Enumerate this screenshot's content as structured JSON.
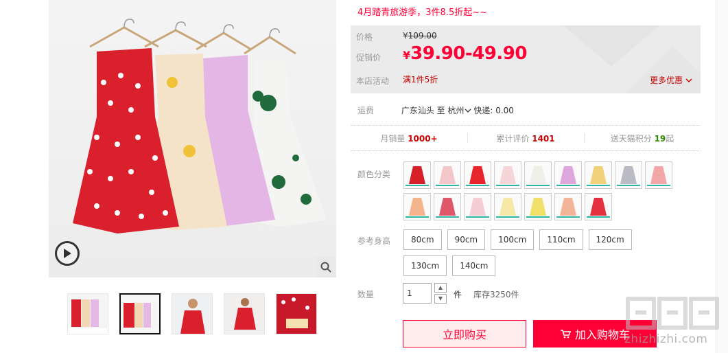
{
  "promo_text": "4月踏青旅游季，3件8.5折起~~",
  "price": {
    "orig_label": "价格",
    "orig_currency": "¥",
    "orig_value": "109.00",
    "promo_label": "促销价",
    "promo_currency": "¥",
    "promo_value": "39.90-49.90",
    "activity_label": "本店活动",
    "activity_value": "满1件5折",
    "more_label": "更多优惠"
  },
  "shipping": {
    "label": "运费",
    "from": "广东汕头",
    "to_word": "至",
    "to": "杭州",
    "express": "快递: 0.00"
  },
  "stats": {
    "monthly_label": "月销量",
    "monthly_value": "1000+",
    "reviews_label": "累计评价",
    "reviews_value": "1401",
    "points_label": "送天猫积分",
    "points_value": "19",
    "points_suffix": "起"
  },
  "color_label": "颜色分类",
  "colors": [
    {
      "name": "red-polka",
      "color": "#d8202a"
    },
    {
      "name": "pink",
      "color": "#f3c6c9"
    },
    {
      "name": "red-bright",
      "color": "#e6262c"
    },
    {
      "name": "light-pink",
      "color": "#f5d5d8"
    },
    {
      "name": "white-floral",
      "color": "#f0eee8"
    },
    {
      "name": "lilac",
      "color": "#dda6dc"
    },
    {
      "name": "yellow-floral",
      "color": "#f1d27a"
    },
    {
      "name": "gray-plaid",
      "color": "#b9bac4"
    },
    {
      "name": "coral",
      "color": "#f3a6a8"
    },
    {
      "name": "orange-floral",
      "color": "#f6b48e"
    },
    {
      "name": "rose",
      "color": "#e0566a"
    },
    {
      "name": "blush",
      "color": "#f7cdd4"
    },
    {
      "name": "cream-yellow",
      "color": "#f6e9a8"
    },
    {
      "name": "lemon",
      "color": "#f0e06a"
    },
    {
      "name": "peach-floral",
      "color": "#f3b59a"
    },
    {
      "name": "red-ruffle",
      "color": "#e43040"
    }
  ],
  "size_label": "参考身高",
  "sizes": [
    "80cm",
    "90cm",
    "100cm",
    "110cm",
    "120cm",
    "130cm",
    "140cm"
  ],
  "quantity": {
    "label": "数量",
    "value": "1",
    "unit": "件",
    "stock": "库存3250件"
  },
  "buttons": {
    "buy_now": "立即购买",
    "add_cart": "加入购物车"
  },
  "watermark": {
    "url": "zhizhizhi.com"
  },
  "accent": "#ff0036"
}
